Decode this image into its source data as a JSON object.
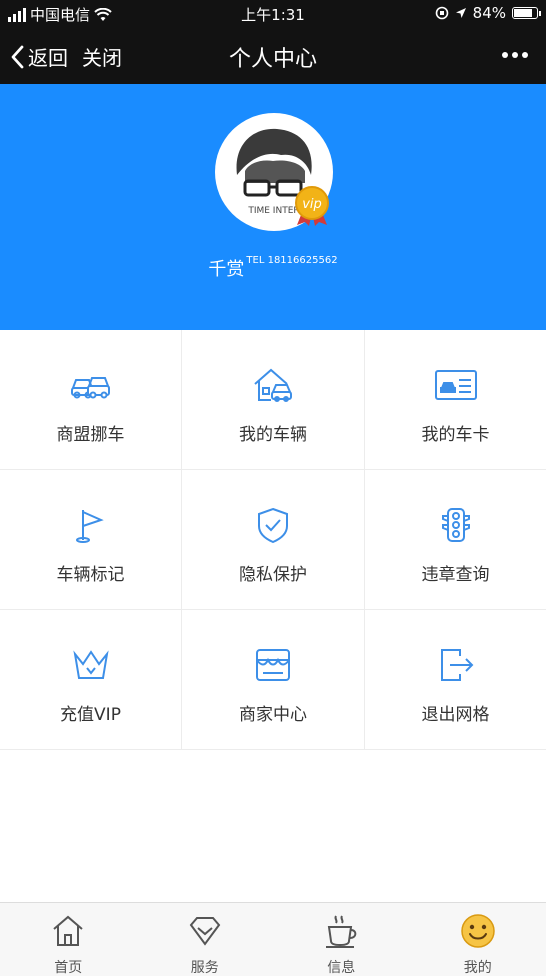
{
  "status_bar": {
    "carrier": "中国电信",
    "time": "上午1:31",
    "battery": "84%",
    "battery_level": 0.84
  },
  "nav": {
    "back_label": "返回",
    "close_label": "关闭",
    "title": "个人中心",
    "more_icon": "more-icon"
  },
  "profile": {
    "name": "千赏",
    "tel": "TEL 18116625562",
    "avatar_text": "TIME INTER",
    "badge": "vip"
  },
  "menu": [
    {
      "label": "商盟挪车",
      "icon": "cars-icon"
    },
    {
      "label": "我的车辆",
      "icon": "house-car-icon"
    },
    {
      "label": "我的车卡",
      "icon": "car-card-icon"
    },
    {
      "label": "车辆标记",
      "icon": "flag-icon"
    },
    {
      "label": "隐私保护",
      "icon": "shield-check-icon"
    },
    {
      "label": "违章查询",
      "icon": "traffic-light-icon"
    },
    {
      "label": "充值VIP",
      "icon": "crown-icon"
    },
    {
      "label": "商家中心",
      "icon": "store-icon"
    },
    {
      "label": "退出网格",
      "icon": "logout-icon"
    }
  ],
  "tabs": [
    {
      "label": "首页",
      "icon": "home-icon"
    },
    {
      "label": "服务",
      "icon": "diamond-icon"
    },
    {
      "label": "信息",
      "icon": "coffee-icon"
    },
    {
      "label": "我的",
      "icon": "smiley-icon"
    }
  ],
  "colors": {
    "brand_blue": "#1a8cff",
    "icon_blue": "#3d8fe8",
    "dark_bar": "#121212",
    "badge_gold": "#f2b317"
  }
}
